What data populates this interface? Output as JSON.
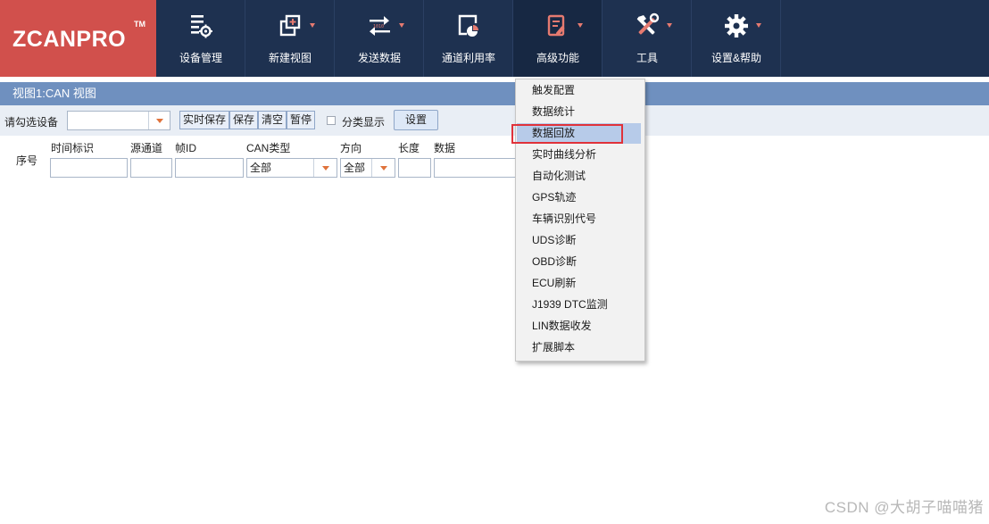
{
  "logo": {
    "text": "ZCANPRO",
    "tm": "TM"
  },
  "toolbar": [
    {
      "label": "设备管理",
      "icon": "device-settings-icon"
    },
    {
      "label": "新建视图",
      "icon": "new-view-icon"
    },
    {
      "label": "发送数据",
      "icon": "send-data-icon"
    },
    {
      "label": "通道利用率",
      "icon": "channel-usage-icon"
    },
    {
      "label": "高级功能",
      "icon": "advanced-functions-icon"
    },
    {
      "label": "工具",
      "icon": "tools-icon"
    },
    {
      "label": "设置&帮助",
      "icon": "gear-icon"
    }
  ],
  "view": {
    "title": "视图1:CAN 视图"
  },
  "controls": {
    "device_label": "请勾选设备",
    "device_value": "",
    "realtime_save": "实时保存",
    "save": "保存",
    "clear": "清空",
    "pause": "暂停",
    "classify": "分类显示",
    "settings": "设置"
  },
  "table": {
    "seq": "序号",
    "columns": {
      "time": "时间标识",
      "channel": "源通道",
      "frame_id": "帧ID",
      "can_type": "CAN类型",
      "direction": "方向",
      "length": "长度",
      "data": "数据"
    },
    "filters": {
      "can_type": "全部",
      "direction": "全部"
    }
  },
  "menu": {
    "items": [
      "触发配置",
      "数据统计",
      "数据回放",
      "实时曲线分析",
      "自动化测试",
      "GPS轨迹",
      "车辆识别代号",
      "UDS诊断",
      "OBD诊断",
      "ECU刷新",
      "J1939 DTC监测",
      "LIN数据收发",
      "扩展脚本"
    ]
  },
  "colors": {
    "topbar": "#1e3150",
    "logo_bg": "#d1504c",
    "accent": "#e57a70",
    "view_title_bg": "#6f90bf",
    "highlight": "#e0323a"
  },
  "watermark": "CSDN @大胡子喵喵猪"
}
